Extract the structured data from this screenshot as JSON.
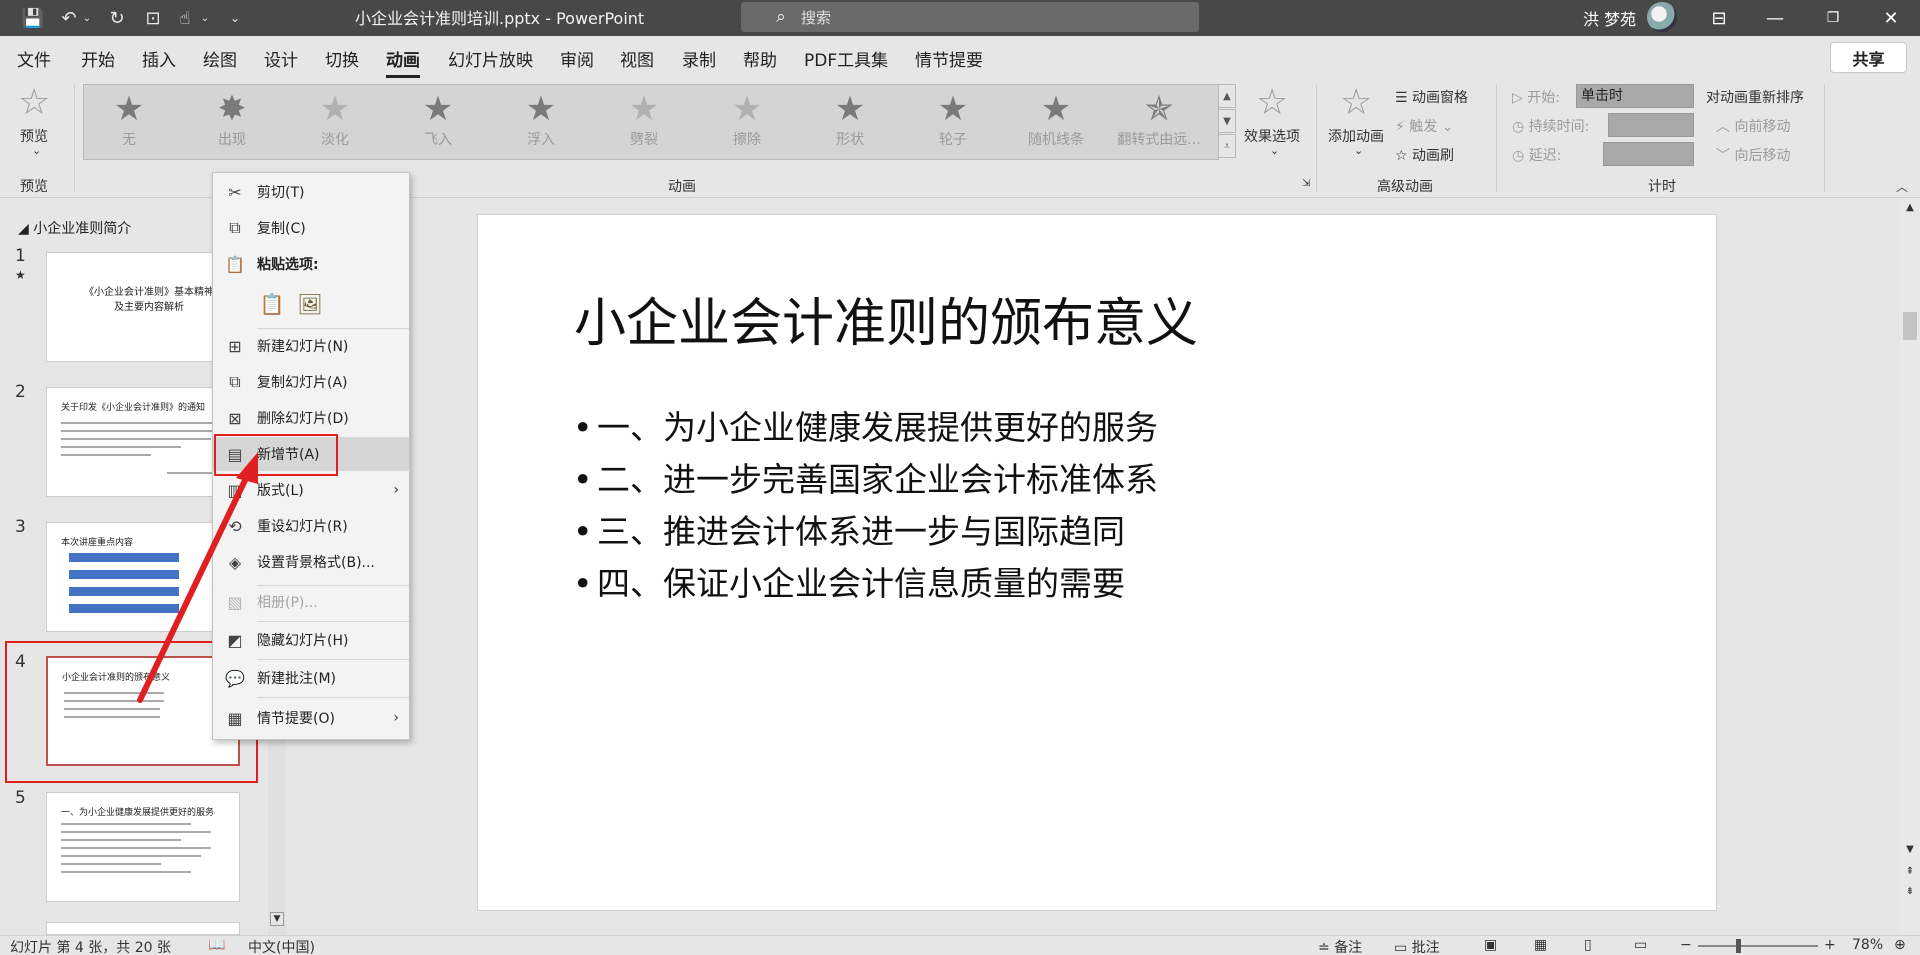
{
  "window": {
    "title": "小企业会计准则培训.pptx  -  PowerPoint",
    "search_placeholder": "搜索",
    "user": "洪 梦苑"
  },
  "menu_tabs": [
    "文件",
    "开始",
    "插入",
    "绘图",
    "设计",
    "切换",
    "动画",
    "幻灯片放映",
    "审阅",
    "视图",
    "录制",
    "帮助",
    "PDF工具集",
    "情节提要"
  ],
  "active_tab": "动画",
  "share_label": "共享",
  "ribbon": {
    "preview_label": "预览",
    "preview_group": "预览",
    "animation_group": "动画",
    "animations": [
      "无",
      "出现",
      "淡化",
      "飞入",
      "浮入",
      "劈裂",
      "擦除",
      "形状",
      "轮子",
      "随机线条",
      "翻转式由远..."
    ],
    "effect_options": "效果选项",
    "advanced_group": "高级动画",
    "add_animation": "添加动画",
    "animation_pane": "动画窗格",
    "trigger": "触发",
    "animation_painter": "动画刷",
    "timing_group": "计时",
    "start_label": "开始:",
    "start_value": "单击时",
    "duration_label": "持续时间:",
    "delay_label": "延迟:",
    "reorder_label": "对动画重新排序",
    "move_earlier": "向前移动",
    "move_later": "向后移动"
  },
  "thumbnails": {
    "section": "小企业准则简介",
    "slides": [
      {
        "num": "1",
        "title": "《小企业会计准则》基本精神及主要内容解析"
      },
      {
        "num": "2",
        "title": "关于印发《小企业会计准则》的通知"
      },
      {
        "num": "3",
        "title": "本次讲座重点内容"
      },
      {
        "num": "4",
        "title": "小企业会计准则的颁布意义"
      },
      {
        "num": "5",
        "title": "一、为小企业健康发展提供更好的服务"
      }
    ]
  },
  "context_menu": {
    "cut": "剪切(T)",
    "copy": "复制(C)",
    "paste_options": "粘贴选项:",
    "new_slide": "新建幻灯片(N)",
    "duplicate_slide": "复制幻灯片(A)",
    "delete_slide": "删除幻灯片(D)",
    "add_section": "新增节(A)",
    "layout": "版式(L)",
    "reset_slide": "重设幻灯片(R)",
    "format_background": "设置背景格式(B)...",
    "photo_album": "相册(P)...",
    "hide_slide": "隐藏幻灯片(H)",
    "new_comment": "新建批注(M)",
    "storyboard": "情节提要(O)"
  },
  "slide": {
    "title": "小企业会计准则的颁布意义",
    "bullets": [
      "一、为小企业健康发展提供更好的服务",
      "二、进一步完善国家企业会计标准体系",
      "三、推进会计体系进一步与国际趋同",
      "四、保证小企业会计信息质量的需要"
    ]
  },
  "status": {
    "slide_count": "幻灯片 第 4 张，共 20 张",
    "language": "中文(中国)",
    "notes": "备注",
    "comments": "批注",
    "zoom": "78%"
  },
  "colors": {
    "accent_red": "#e02020",
    "titlebar": "#484848"
  }
}
